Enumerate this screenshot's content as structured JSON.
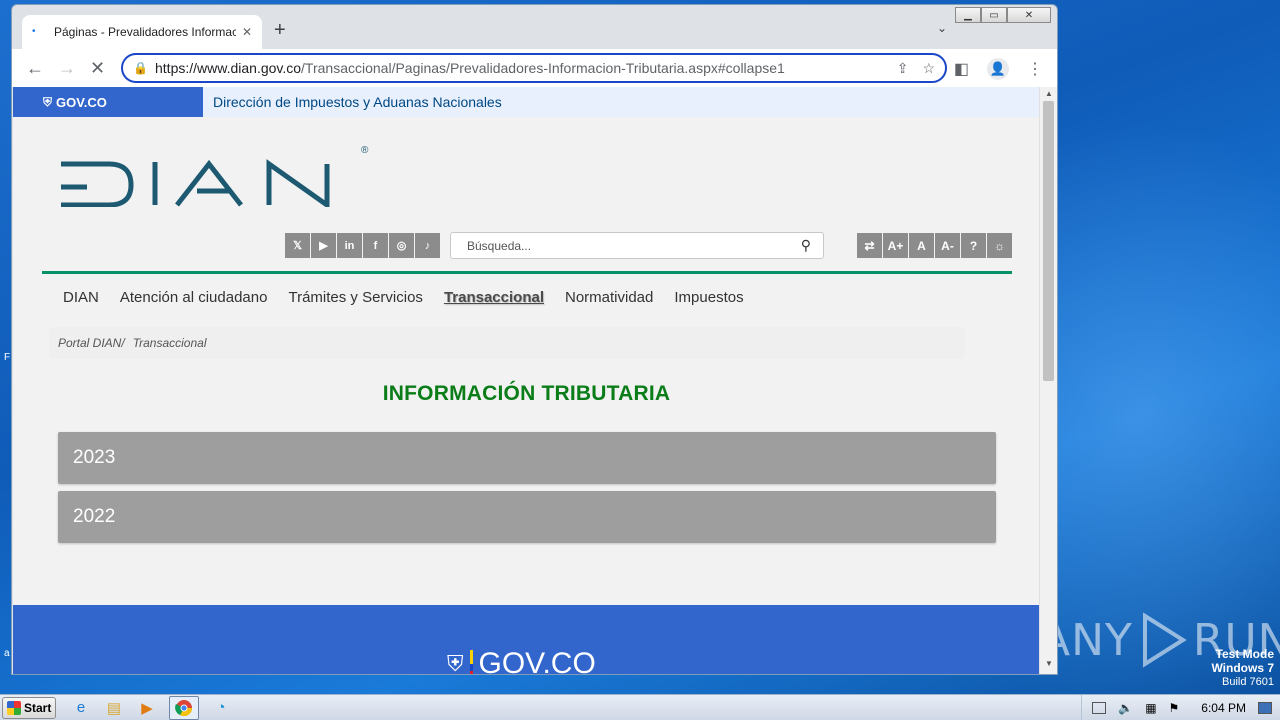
{
  "browser": {
    "tab_title": "Páginas - Prevalidadores Informacion",
    "tab_close": "✕",
    "new_tab": "+",
    "tab_menu": "⌄",
    "url_host": "https://www.dian.gov.co",
    "url_path": "/Transaccional/Paginas/Prevalidadores-Informacion-Tributaria.aspx#collapse1",
    "window_controls": [
      "▁",
      "▭",
      "✕"
    ]
  },
  "page": {
    "gov_logo": "GOV.CO",
    "gov_bar_text": "Dirección de Impuestos y Aduanas Nacionales",
    "brand": "DIAN",
    "registered": "®",
    "social": [
      "𝕏",
      "▶",
      "in",
      "f",
      "◎",
      "♪"
    ],
    "search_placeholder": "Búsqueda...",
    "a11y": [
      "⇄",
      "A+",
      "A",
      "A-",
      "?",
      "☼"
    ],
    "nav": [
      "DIAN",
      "Atención al ciudadano",
      "Trámites y Servicios",
      "Transaccional",
      "Normatividad",
      "Impuestos"
    ],
    "nav_active_index": 3,
    "breadcrumb": [
      "Portal DIAN/",
      "Transaccional"
    ],
    "title": "INFORMACIÓN TRIBUTARIA",
    "accordion": [
      "2023",
      "2022"
    ],
    "footer_logo": "GOV.CO"
  },
  "desktop": {
    "watermark": "ANY RUN",
    "test_mode": [
      "Test Mode",
      "Windows 7",
      "Build 7601"
    ]
  },
  "taskbar": {
    "start": "Start",
    "clock": "6:04 PM"
  },
  "colors": {
    "gov_blue": "#3366cc",
    "title_green": "#0a7d18",
    "accordion_gray": "#9e9e9e",
    "line_green": "#069169"
  }
}
